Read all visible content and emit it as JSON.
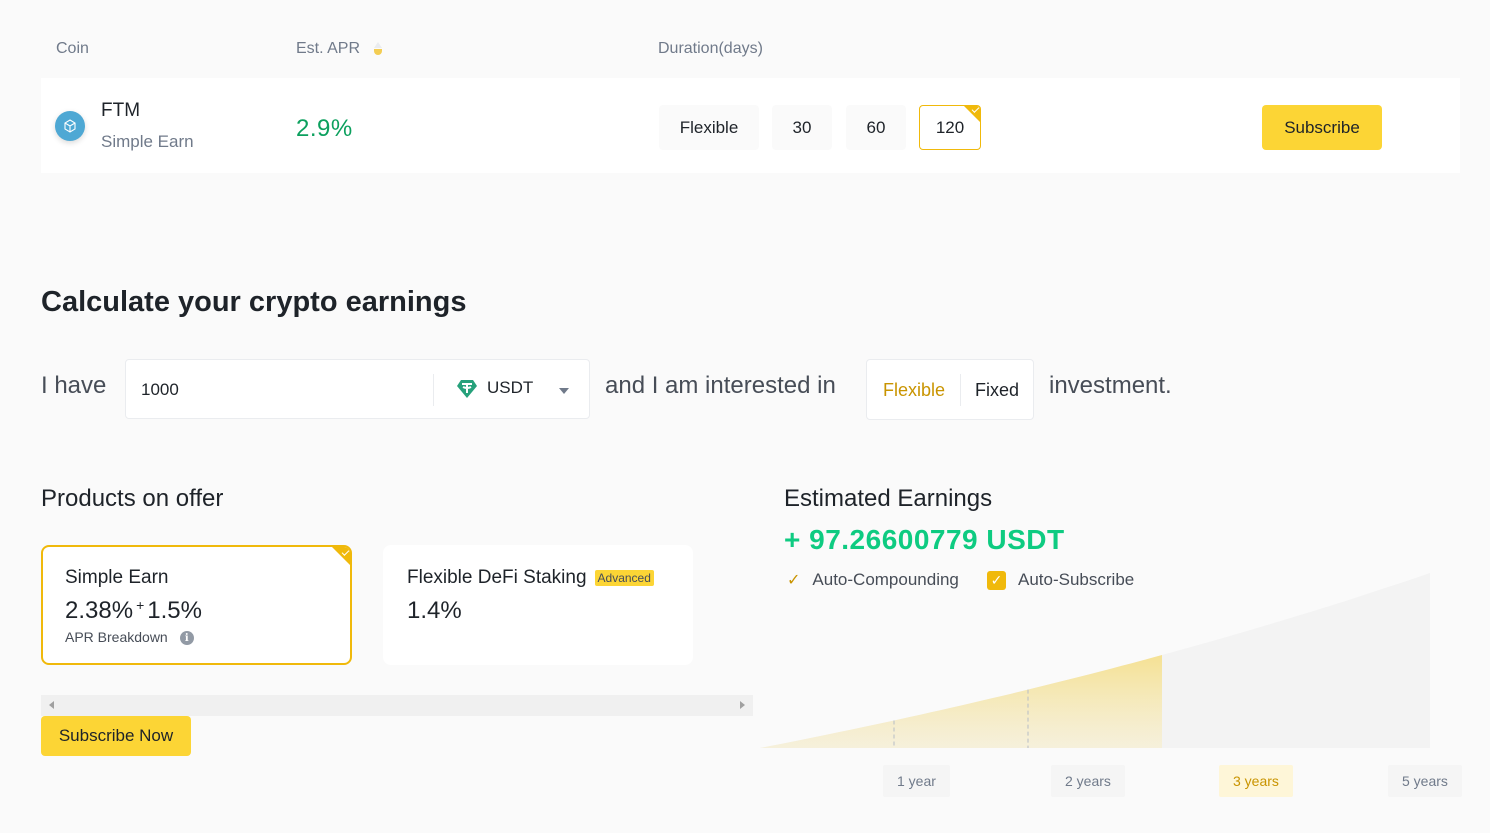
{
  "table": {
    "headers": {
      "coin": "Coin",
      "apr": "Est. APR",
      "duration": "Duration(days)"
    },
    "sort_icon": "sort-icon",
    "row": {
      "coin": "FTM",
      "coin_icon": "fantom-logo",
      "product": "Simple Earn",
      "apr": "2.9%",
      "durations": [
        "Flexible",
        "30",
        "60",
        "120"
      ],
      "selected_duration": "120",
      "subscribe_label": "Subscribe"
    }
  },
  "calculator": {
    "title": "Calculate your crypto earnings",
    "prefix": "I have",
    "amount": "1000",
    "asset": "USDT",
    "asset_icon": "tether-icon",
    "middle": "and I am interested in",
    "types": [
      "Flexible",
      "Fixed"
    ],
    "selected_type": "Flexible",
    "suffix": "investment."
  },
  "products": {
    "title": "Products on offer",
    "items": [
      {
        "name": "Simple Earn",
        "apr_base": "2.38%",
        "apr_plus": "+",
        "apr_bonus": "1.5%",
        "breakdown": "APR Breakdown",
        "selected": true
      },
      {
        "name": "Flexible DeFi Staking",
        "badge": "Advanced",
        "apr": "1.4%",
        "selected": false
      }
    ],
    "subscribe_now": "Subscribe Now"
  },
  "earnings": {
    "title": "Estimated Earnings",
    "value": "+ 97.26600779 USDT",
    "options": [
      {
        "label": "Auto-Compounding",
        "checked": true,
        "style": "plain"
      },
      {
        "label": "Auto-Subscribe",
        "checked": true,
        "style": "box"
      }
    ]
  },
  "chart_data": {
    "type": "area",
    "title": "Estimated Earnings",
    "x": [
      0,
      1,
      2,
      3,
      5
    ],
    "categories": [
      "1 year",
      "2 years",
      "3 years",
      "5 years"
    ],
    "selected": "3 years",
    "series": [
      {
        "name": "Estimated Earnings (USDT)",
        "values": [
          0,
          29.3,
          61.2,
          97.27,
          172
        ]
      }
    ],
    "xlabel": "",
    "ylabel": "",
    "grid": false
  },
  "colors": {
    "accent": "#fcd535",
    "brand": "#f0b90b",
    "positive": "#0ecb81",
    "apr_green": "#0ca05e"
  }
}
